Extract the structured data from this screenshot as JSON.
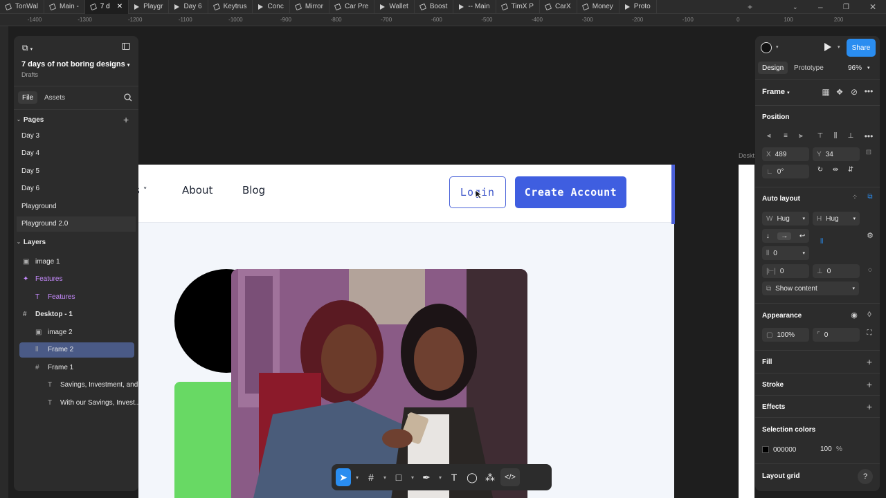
{
  "tabs": [
    {
      "label": "TonWal",
      "icon": "file"
    },
    {
      "label": "Main -",
      "icon": "file"
    },
    {
      "label": "7 d",
      "icon": "file",
      "active": true
    },
    {
      "label": "Playgr",
      "icon": "play"
    },
    {
      "label": "Day 6",
      "icon": "play"
    },
    {
      "label": "Keytrus",
      "icon": "file"
    },
    {
      "label": "Conc",
      "icon": "play"
    },
    {
      "label": "Mirror",
      "icon": "file"
    },
    {
      "label": "Car Pre",
      "icon": "file"
    },
    {
      "label": "Wallet",
      "icon": "play"
    },
    {
      "label": "Boost",
      "icon": "file"
    },
    {
      "label": "-- Main",
      "icon": "play"
    },
    {
      "label": "TimX P",
      "icon": "file"
    },
    {
      "label": "CarX",
      "icon": "file"
    },
    {
      "label": "Money",
      "icon": "file"
    },
    {
      "label": "Proto",
      "icon": "play"
    }
  ],
  "ruler_ticks": [
    "-1400",
    "-1300",
    "-1200",
    "-1100",
    "-1000",
    "-900",
    "-800",
    "-700",
    "-600",
    "-500",
    "-400",
    "-300",
    "-200",
    "-100",
    "0",
    "100",
    "200"
  ],
  "left_panel": {
    "file_name": "7 days of not boring designs",
    "location": "Drafts",
    "tab_file": "File",
    "tab_assets": "Assets",
    "pages_heading": "Pages",
    "pages": [
      "Day 3",
      "Day 4",
      "Day 5",
      "Day 6",
      "Playground",
      "Playground 2.0"
    ],
    "layers_heading": "Layers",
    "layers": [
      {
        "label": "image 1",
        "icon": "image-icon",
        "indent": 0
      },
      {
        "label": "Features",
        "icon": "component-icon",
        "indent": 0,
        "color": "#c78bff"
      },
      {
        "label": "Features",
        "icon": "text-icon",
        "indent": 1,
        "color": "#c78bff"
      },
      {
        "label": "Desktop - 1",
        "icon": "frame-icon",
        "indent": 0,
        "bold": true
      },
      {
        "label": "image 2",
        "icon": "image-icon",
        "indent": 1
      },
      {
        "label": "Frame 2",
        "icon": "autolayout-icon",
        "indent": 1,
        "selected": true
      },
      {
        "label": "Frame 1",
        "icon": "frame-icon",
        "indent": 1
      },
      {
        "label": "Savings, Investment, and...",
        "icon": "text-icon",
        "indent": 2
      },
      {
        "label": "With our Savings, Invest...",
        "icon": "text-icon",
        "indent": 2
      }
    ]
  },
  "design_frame": {
    "nav_partial": "s",
    "nav_about": "About",
    "nav_blog": "Blog",
    "login_label": "Login",
    "create_label": "Create Account",
    "right_frame_label": "Deskt"
  },
  "right_panel": {
    "share_label": "Share",
    "tab_design": "Design",
    "tab_prototype": "Prototype",
    "zoom": "96%",
    "frame_label": "Frame",
    "position_heading": "Position",
    "x_label": "X",
    "x_value": "489",
    "y_label": "Y",
    "y_value": "34",
    "rotation": "0°",
    "autolayout_heading": "Auto layout",
    "w_label": "W",
    "w_value": "Hug",
    "h_label": "H",
    "h_value": "Hug",
    "gap_value": "0",
    "pad_h_value": "0",
    "pad_v_value": "0",
    "show_content": "Show content",
    "appearance_heading": "Appearance",
    "opacity": "100%",
    "corner_radius": "0",
    "fill_heading": "Fill",
    "stroke_heading": "Stroke",
    "effects_heading": "Effects",
    "selection_colors_heading": "Selection colors",
    "sel_color_hex": "000000",
    "sel_color_opacity": "100",
    "sel_color_pct": "%",
    "layout_grid_heading": "Layout grid",
    "help": "?"
  },
  "colors": {
    "accent": "#2a8df0",
    "brand_blue": "#3f5ee0",
    "green": "#68d964"
  }
}
